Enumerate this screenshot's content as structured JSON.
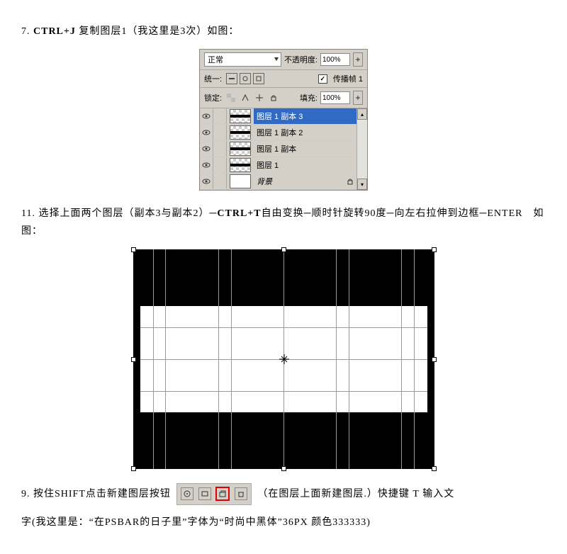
{
  "step7": {
    "prefix": "7. ",
    "bold": "CTRL+J",
    "rest": " 复制图层1（我这里是3次）如图："
  },
  "layersPanel": {
    "blend": "正常",
    "opacityLabel": "不透明度:",
    "opacityValue": "100%",
    "unifyLabel": "统一:",
    "propagateLabel": "传播帧 1",
    "lockLabel": "锁定:",
    "fillLabel": "填充:",
    "fillValue": "100%",
    "layers": [
      {
        "name": "图层 1 副本 3"
      },
      {
        "name": "图层 1 副本 2"
      },
      {
        "name": "图层 1 副本"
      },
      {
        "name": "图层 1"
      },
      {
        "name": "背景"
      }
    ]
  },
  "step11": {
    "prefix": "11. 选择上面两个图层（副本3与副本2）─",
    "bold1": "CTRL+T",
    "mid": "自由变换─顺时针旋转90度─向左右拉伸到边框─ENTER　如图："
  },
  "step9": {
    "prefix": "9. 按住SHIFT点击新建图层按钮 ",
    "after": "（在图层上面新建图层.）快捷键 T 输入文"
  },
  "lastLine": "字(我这里是：“在PSBAR的日子里”字体为“时尚中黑体”36PX 颜色333333)"
}
